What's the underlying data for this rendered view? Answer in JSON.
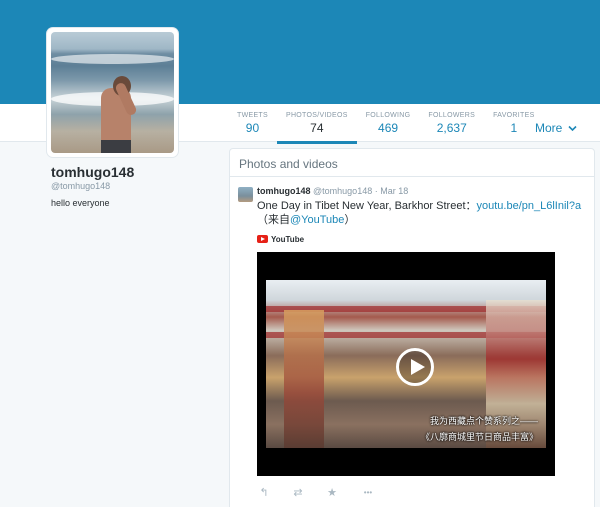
{
  "profile": {
    "name": "tomhugo148",
    "handle": "@tomhugo148",
    "bio": "hello everyone"
  },
  "stats": [
    {
      "label": "TWEETS",
      "value": "90"
    },
    {
      "label": "PHOTOS/VIDEOS",
      "value": "74"
    },
    {
      "label": "FOLLOWING",
      "value": "469"
    },
    {
      "label": "FOLLOWERS",
      "value": "2,637"
    },
    {
      "label": "FAVORITES",
      "value": "1"
    }
  ],
  "more_label": "More",
  "section_title": "Photos and videos",
  "tweet": {
    "name": "tomhugo148",
    "handle": "@tomhugo148",
    "dot": "·",
    "date": "Mar 18",
    "text_part1": "One Day in Tibet New Year, Barkhor Street：",
    "link": "youtu.be/pn_L6lInil?a",
    "text_part2": "（来自",
    "mention": "@YouTube",
    "text_part3": "）",
    "source_label": "YouTube",
    "subtitle_1": "我为西藏点个赞系列之——",
    "subtitle_2": "《八廓商城里节日商品丰富》"
  },
  "actions": {
    "reply": "↰",
    "retweet": "⇄",
    "favorite": "★",
    "more": "•••"
  },
  "colors": {
    "accent": "#1c87b7",
    "banner": "#1c87b7"
  }
}
